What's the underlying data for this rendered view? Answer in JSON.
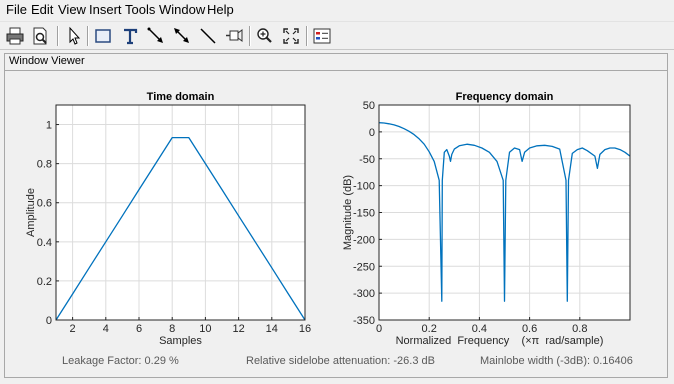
{
  "menu": [
    "File",
    "Edit",
    "View",
    "Insert",
    "Tools",
    "Window",
    "Help"
  ],
  "toolbar": {
    "buttons": [
      "print-icon",
      "print-preview-icon",
      "pointer-icon",
      "insert-rectangle-icon",
      "insert-text-icon",
      "insert-arrow-icon",
      "insert-double-arrow-icon",
      "insert-line-icon",
      "pin-icon",
      "zoom-in-icon",
      "fit-view-icon",
      "legend-icon"
    ]
  },
  "panel": {
    "title": "Window Viewer"
  },
  "colors": {
    "line": "#0072bd",
    "grid": "#dcdcdc",
    "axes_bg": "#ffffff"
  },
  "stats": {
    "leakage": "Leakage Factor: 0.29 %",
    "sidelobe": "Relative sidelobe attenuation: -26.3 dB",
    "mainlobe": "Mainlobe width (-3dB): 0.16406"
  },
  "chart_data": [
    {
      "type": "line",
      "title": "Time domain",
      "xlabel": "Samples",
      "ylabel": "Amplitude",
      "xlim": [
        1,
        16
      ],
      "ylim": [
        0,
        1.1
      ],
      "xticks": [
        2,
        4,
        6,
        8,
        10,
        12,
        14,
        16
      ],
      "yticks": [
        0,
        0.2,
        0.4,
        0.6,
        0.8,
        1
      ],
      "grid": true,
      "x": [
        1,
        2,
        3,
        4,
        5,
        6,
        7,
        8,
        9,
        10,
        11,
        12,
        13,
        14,
        15,
        16
      ],
      "y": [
        0,
        0.133,
        0.267,
        0.4,
        0.533,
        0.667,
        0.8,
        0.933,
        0.933,
        0.8,
        0.667,
        0.533,
        0.4,
        0.267,
        0.133,
        0
      ]
    },
    {
      "type": "line",
      "title": "Frequency domain",
      "xlabel": "Normalized  Frequency    (×π  rad/sample)",
      "ylabel": "Magnitude (dB)",
      "xlim": [
        0,
        1
      ],
      "ylim": [
        -350,
        50
      ],
      "xticks": [
        0,
        0.2,
        0.4,
        0.6,
        0.8
      ],
      "yticks": [
        50,
        0,
        -50,
        -100,
        -150,
        -200,
        -250,
        -300,
        -350
      ],
      "grid": true,
      "x": [
        0,
        0.02,
        0.04,
        0.06,
        0.08,
        0.1,
        0.12,
        0.14,
        0.16,
        0.18,
        0.2,
        0.22,
        0.24,
        0.25,
        0.252,
        0.26,
        0.27,
        0.28,
        0.285,
        0.29,
        0.3,
        0.32,
        0.35,
        0.38,
        0.41,
        0.44,
        0.47,
        0.495,
        0.5,
        0.505,
        0.52,
        0.54,
        0.56,
        0.57,
        0.58,
        0.6,
        0.63,
        0.66,
        0.69,
        0.72,
        0.745,
        0.75,
        0.755,
        0.77,
        0.79,
        0.81,
        0.83,
        0.86,
        0.87,
        0.88,
        0.9,
        0.92,
        0.94,
        0.96,
        0.98,
        1.0
      ],
      "y": [
        17,
        16.5,
        15,
        13,
        10,
        6,
        1,
        -5,
        -13,
        -23,
        -37,
        -55,
        -90,
        -315,
        -90,
        -38,
        -33,
        -45,
        -55,
        -42,
        -32,
        -26,
        -23,
        -25,
        -30,
        -38,
        -55,
        -90,
        -315,
        -90,
        -38,
        -30,
        -33,
        -55,
        -38,
        -30,
        -26,
        -25,
        -27,
        -32,
        -90,
        -315,
        -90,
        -40,
        -33,
        -30,
        -35,
        -45,
        -68,
        -42,
        -33,
        -30,
        -30,
        -33,
        -38,
        -45
      ]
    }
  ]
}
